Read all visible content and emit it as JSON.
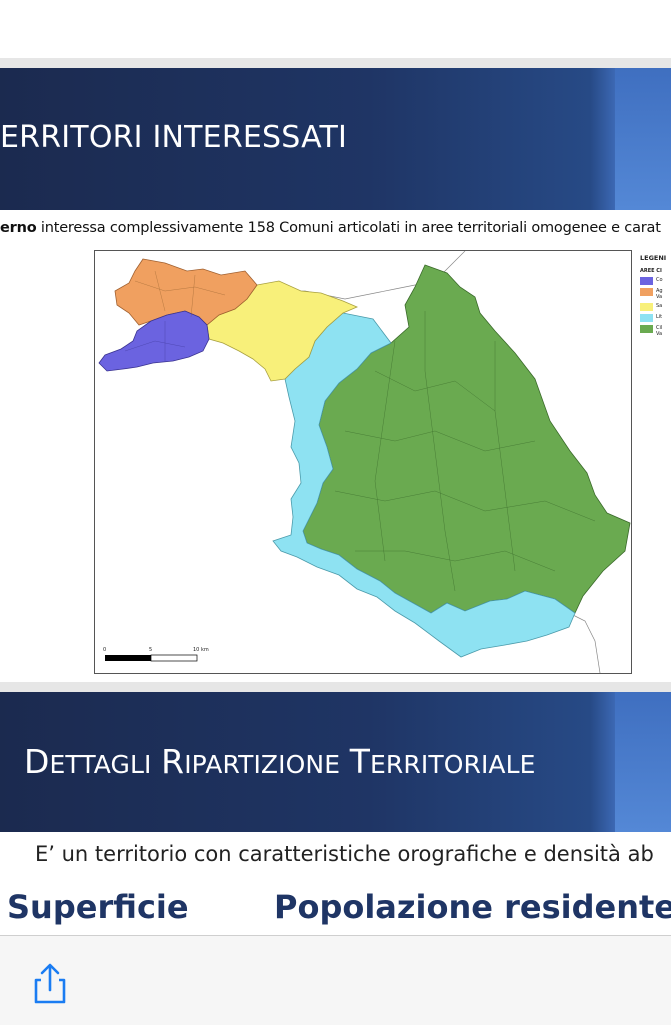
{
  "slide1": {
    "title": "ERRITORI INTERESSATI",
    "intro_bold": "erno",
    "intro_text": " interessa complessivamente 158 Comuni articolati in aree territoriali omogenee e carat"
  },
  "map": {
    "scale_start": "0",
    "scale_mid": "5",
    "scale_end": "10 km",
    "legend_title": "LEGENI",
    "legend_subtitle": "AREE CI",
    "legend_items": [
      {
        "label": "Co",
        "color": "#6b63e0"
      },
      {
        "label": "Ag\nVa",
        "color": "#f0a060"
      },
      {
        "label": "Sa",
        "color": "#f8f07a"
      },
      {
        "label": "Lit",
        "color": "#8ee2f2"
      },
      {
        "label": "Cil\nVa",
        "color": "#6aaa50"
      }
    ],
    "colors": {
      "purple": "#6b63e0",
      "orange": "#f0a060",
      "yellow": "#f8f07a",
      "lightblue": "#8ee2f2",
      "green": "#6aaa50"
    }
  },
  "slide2": {
    "title_cap1": "D",
    "title_rest1": "ETTAGLI",
    "title_cap2": "R",
    "title_rest2": "IPARTIZIONE",
    "title_cap3": "T",
    "title_rest3": "ERRITORIALE",
    "text": "E’ un territorio con caratteristiche orografiche e densità ab",
    "col1": "Superficie",
    "col2": "Popolazione residente"
  },
  "toolbar": {
    "share_icon": "share-icon"
  }
}
